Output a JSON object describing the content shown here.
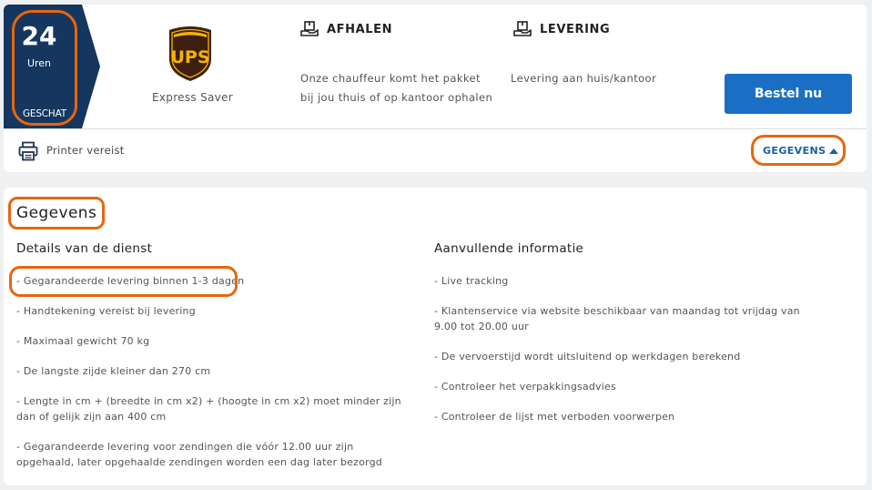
{
  "summary": {
    "duration_value": "24",
    "duration_unit": "Uren",
    "estimate_label": "GESCHAT",
    "carrier_logo": "UPS",
    "service_name": "Express Saver",
    "pickup": {
      "title": "AFHALEN",
      "icon": "parcel-hand-icon",
      "description": "Onze chauffeur komt het pakket bij jou thuis of op kantoor ophalen"
    },
    "delivery": {
      "title": "LEVERING",
      "icon": "parcel-hand-icon",
      "description": "Levering aan huis/kantoor"
    },
    "order_button": "Bestel nu",
    "printer_text": "Printer vereist",
    "details_link": "GEGEVENS",
    "colors": {
      "badge": "#15365f",
      "button": "#1a6fc4",
      "highlight": "#e8660d",
      "link": "#1b5eaa"
    }
  },
  "details": {
    "title": "Gegevens",
    "service_title": "Details van de dienst",
    "service_items": [
      "- Gegarandeerde levering binnen 1-3 dagen",
      "- Handtekening vereist bij levering",
      "- Maximaal gewicht 70 kg",
      "- De langste zijde kleiner dan 270 cm",
      "- Lengte in cm + (breedte in cm x2) + (hoogte in cm x2) moet minder zijn dan of gelijk zijn aan 400 cm",
      "- Gegarandeerde levering voor zendingen die vóór 12.00 uur zijn opgehaald, later opgehaalde zendingen worden een dag later bezorgd"
    ],
    "extra_title": "Aanvullende informatie",
    "extra_items": [
      "- Live tracking",
      "- Klantenservice via website beschikbaar van maandag tot vrijdag van 9.00 tot 20.00 uur",
      "- De vervoerstijd wordt uitsluitend op werkdagen berekend",
      "- Controleer het verpakkingsadvies",
      "- Controleer de lijst met verboden voorwerpen"
    ]
  }
}
